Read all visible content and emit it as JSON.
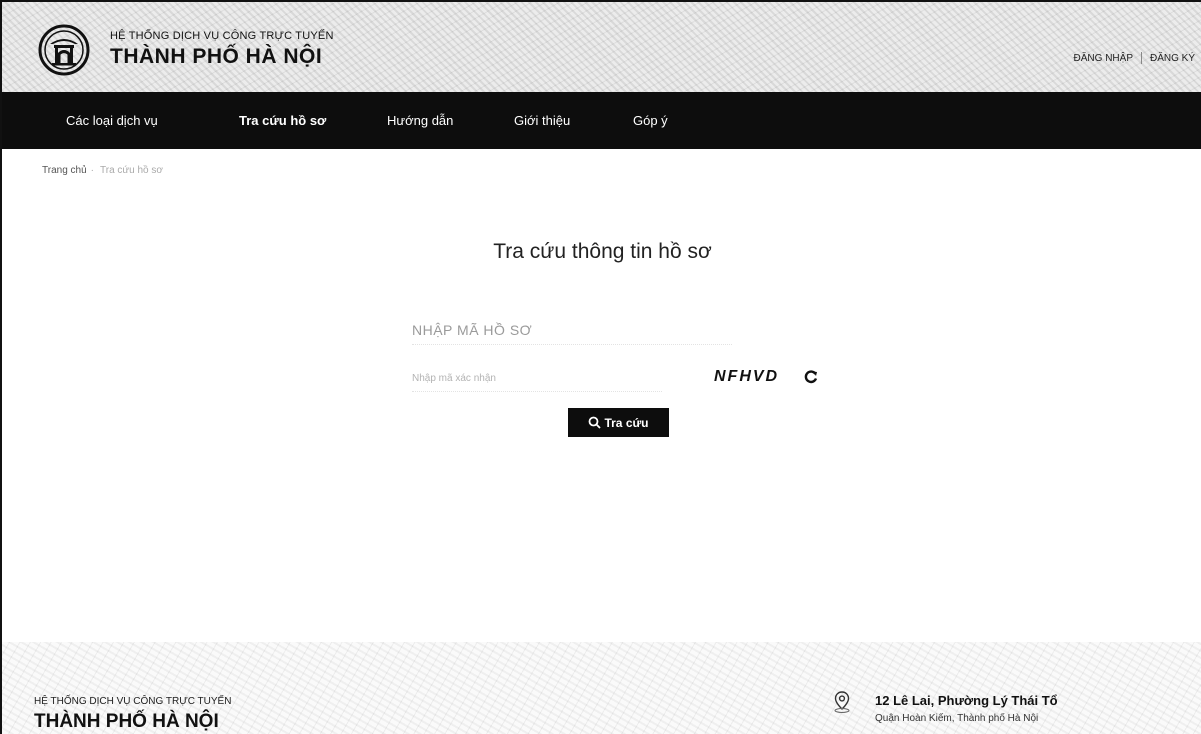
{
  "header": {
    "subtitle": "HỆ THỐNG DỊCH VỤ CÔNG TRỰC TUYẾN",
    "title": "THÀNH PHỐ HÀ NỘI",
    "login_label": "ĐĂNG NHẬP",
    "register_label": "ĐĂNG KÝ"
  },
  "nav": {
    "items": [
      {
        "label": "Các loại dịch vụ"
      },
      {
        "label": "Tra cứu hồ sơ"
      },
      {
        "label": "Hướng dẫn"
      },
      {
        "label": "Giới thiệu"
      },
      {
        "label": "Góp ý"
      }
    ],
    "active_index": 1
  },
  "breadcrumb": {
    "home": "Trang chủ",
    "current": "Tra cứu hồ sơ"
  },
  "main": {
    "title": "Tra cứu thông tin hồ sơ",
    "code_placeholder": "NHẬP MÃ HỒ SƠ",
    "captcha_placeholder": "Nhập mã xác nhận",
    "captcha_text": "NFHVD",
    "search_label": "Tra cứu"
  },
  "footer": {
    "subtitle": "HỆ THỐNG DỊCH VỤ CÔNG TRỰC TUYẾN",
    "title": "THÀNH PHỐ HÀ NỘI",
    "address_line1": "12 Lê Lai, Phường Lý Thái Tổ",
    "address_line2": "Quận Hoàn Kiếm, Thành phố Hà Nội"
  },
  "colors": {
    "nav_background": "#0d0d0d",
    "button_background": "#0d0d0d",
    "text": "#222222"
  },
  "icons": {
    "logo": "hanoi-emblem-icon",
    "refresh": "refresh-icon",
    "search": "search-icon",
    "location": "location-pin-icon"
  }
}
